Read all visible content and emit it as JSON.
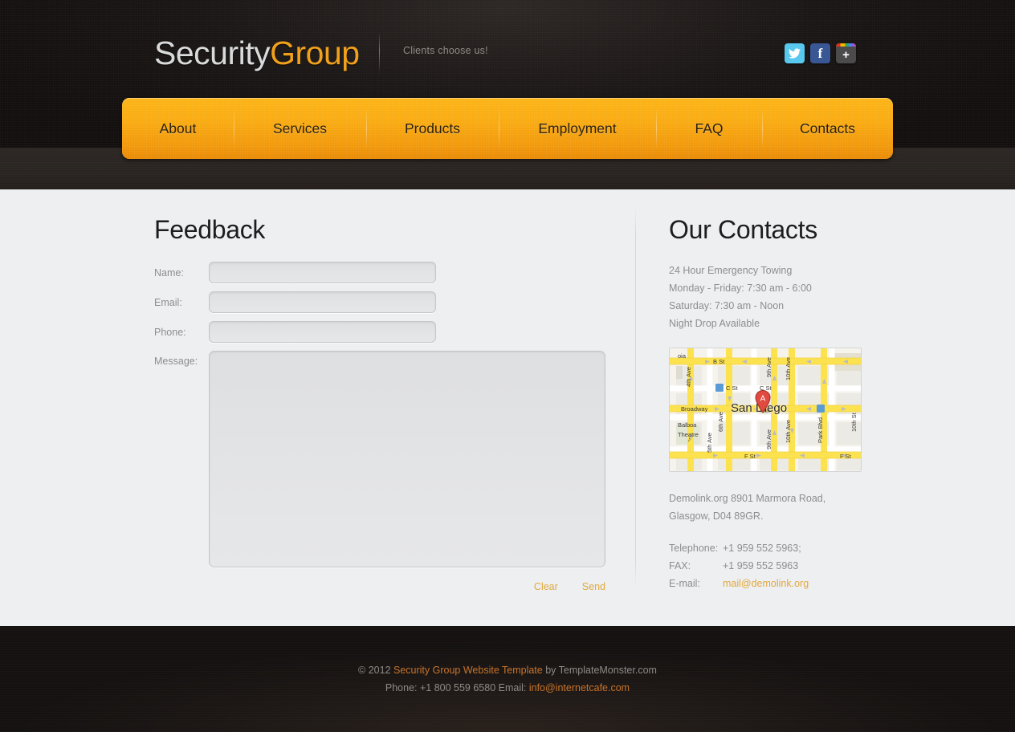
{
  "header": {
    "logo_part1": "Security",
    "logo_part2": "Group",
    "tagline": "Clients choose us!",
    "social": [
      {
        "name": "twitter",
        "label": "t",
        "color": "#59c8ef"
      },
      {
        "name": "facebook",
        "label": "f",
        "color": "#3a5795"
      },
      {
        "name": "google-plus",
        "label": "+",
        "color": "#4b4b4b"
      }
    ]
  },
  "nav": {
    "items": [
      {
        "label": "About"
      },
      {
        "label": "Services"
      },
      {
        "label": "Products"
      },
      {
        "label": "Employment"
      },
      {
        "label": "FAQ"
      },
      {
        "label": "Contacts"
      }
    ]
  },
  "feedback": {
    "title": "Feedback",
    "fields": [
      {
        "label": "Name:",
        "value": "",
        "placeholder": ""
      },
      {
        "label": "Email:",
        "value": "",
        "placeholder": ""
      },
      {
        "label": "Phone:",
        "value": "",
        "placeholder": ""
      }
    ],
    "message_label": "Message:",
    "message_value": "",
    "clear_label": "Clear",
    "send_label": "Send"
  },
  "contacts": {
    "title": "Our Contacts",
    "hours": [
      "24 Hour Emergency Towing",
      "Monday - Friday: 7:30 am - 6:00",
      "Saturday: 7:30 am - Noon",
      "Night Drop Available"
    ],
    "address_line1": "Demolink.org 8901 Marmora Road,",
    "address_line2": "Glasgow, D04 89GR.",
    "telephone_label": "Telephone:",
    "telephone_value": "+1 959 552 5963;",
    "fax_label": "FAX:",
    "fax_value": "+1 959 552 5963",
    "email_label": "E-mail:",
    "email_value": "mail@demolink.org",
    "map": {
      "city": "San Diego",
      "marker": "A",
      "streets": [
        "B St",
        "C St",
        "C St",
        "Broadway",
        "F St",
        "F St",
        "4th Ave",
        "5th Ave",
        "6th Ave",
        "9th Ave",
        "9th Ave",
        "10th Ave",
        "10th Ave",
        "Park Blvd"
      ],
      "places": [
        "Balboa",
        "Theatre",
        "oia"
      ]
    }
  },
  "footer": {
    "copyright_prefix": "© 2012 ",
    "copyright_link": "Security Group Website Template",
    "copyright_suffix": " by TemplateMonster.com",
    "phone_text": "Phone: +1 800 559 6580   Email: ",
    "email_link": "info@internetcafe.com"
  },
  "colors": {
    "accent": "#f0a01c",
    "nav_bg": "#f9aa10",
    "link": "#e0a93d",
    "footer_link": "#c8732a",
    "dark_bg": "#161312",
    "main_bg": "#eeeff1"
  }
}
